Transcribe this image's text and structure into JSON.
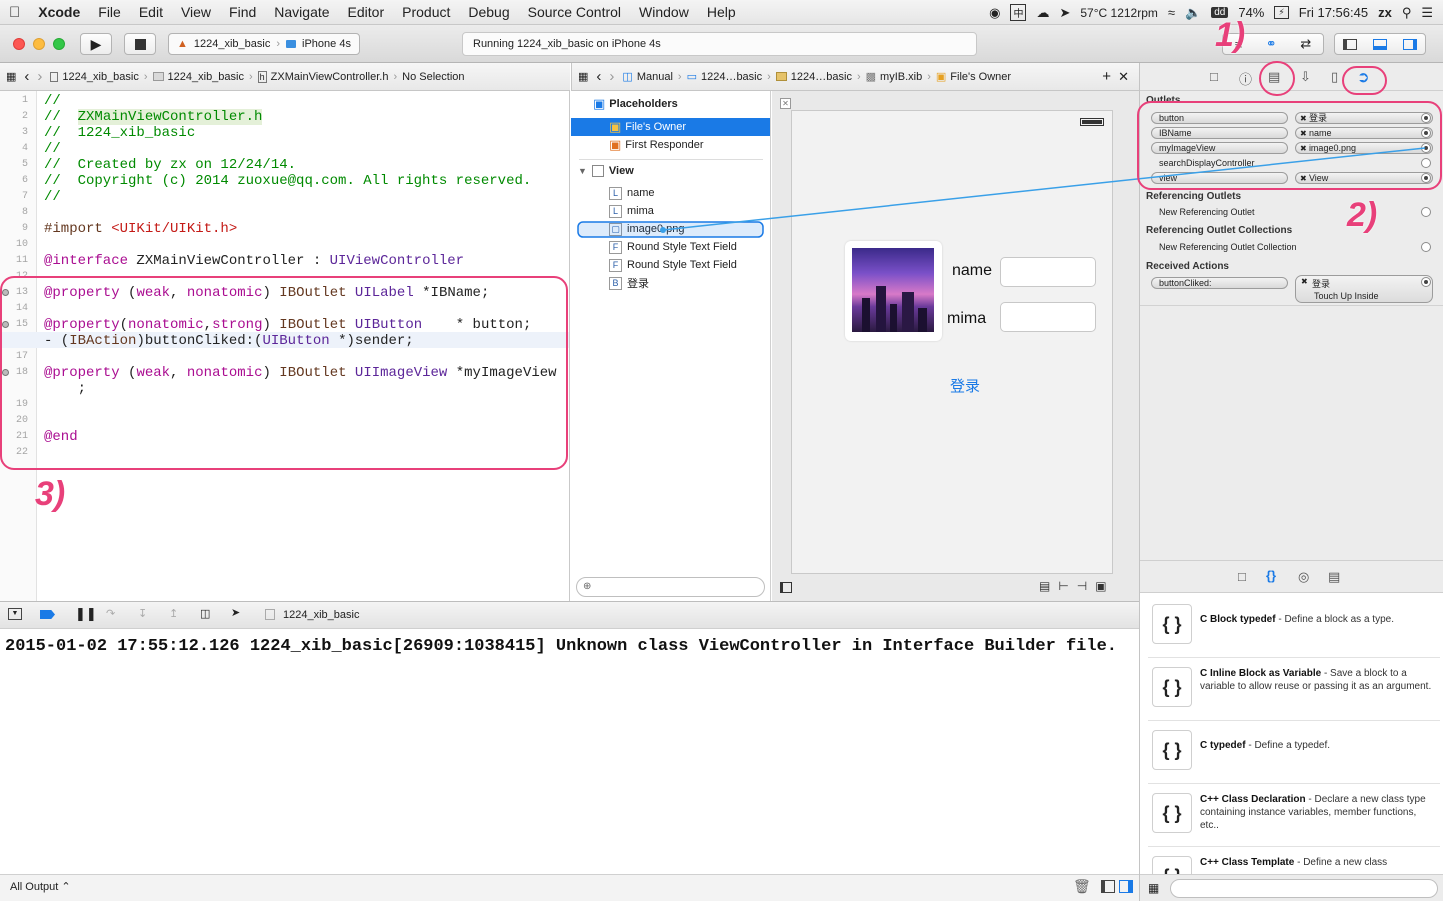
{
  "menubar": {
    "app_name": "Xcode",
    "items": [
      "File",
      "Edit",
      "View",
      "Find",
      "Navigate",
      "Editor",
      "Product",
      "Debug",
      "Source Control",
      "Window",
      "Help"
    ],
    "status": {
      "temp": "57°C 1212rpm",
      "battery": "74%",
      "clock": "Fri 17:56:45",
      "user": "zx"
    }
  },
  "toolbar": {
    "scheme_target": "1224_xib_basic",
    "scheme_device": "iPhone 4s",
    "activity_text": "Running 1224_xib_basic on iPhone 4s"
  },
  "editor_jump": {
    "project": "1224_xib_basic",
    "group": "1224_xib_basic",
    "file": "ZXMainViewController.h",
    "selection": "No Selection"
  },
  "ib_jump": {
    "mode": "Manual",
    "project": "1224…basic",
    "group": "1224…basic",
    "file": "myIB.xib",
    "object": "File's Owner"
  },
  "code": {
    "line_numbers": [
      "1",
      "2",
      "3",
      "4",
      "5",
      "6",
      "7",
      "8",
      "9",
      "10",
      "11",
      "12",
      "13",
      "14",
      "15",
      "16",
      "17",
      "18",
      "",
      "19",
      "20",
      "21",
      "22"
    ],
    "lines": [
      "//",
      "//  ZXMainViewController.h",
      "//  1224_xib_basic",
      "//",
      "//  Created by zx on 12/24/14.",
      "//  Copyright (c) 2014 zuoxue@qq.com. All rights reserved.",
      "//",
      "",
      "#import <UIKit/UIKit.h>",
      "",
      "@interface ZXMainViewController : UIViewController",
      "",
      "@property (weak, nonatomic) IBOutlet UILabel *IBName;",
      "",
      "@property(nonatomic,strong) IBOutlet UIButton    * button;",
      "- (IBAction)buttonCliked:(UIButton *)sender;",
      "",
      "@property (weak, nonatomic) IBOutlet UIImageView *myImageView",
      "    ;",
      "",
      "",
      "@end",
      ""
    ]
  },
  "outline": {
    "placeholders_label": "Placeholders",
    "files_owner": "File's Owner",
    "first_responder": "First Responder",
    "view_label": "View",
    "children": [
      {
        "badge": "L",
        "label": "name"
      },
      {
        "badge": "L",
        "label": "mima"
      },
      {
        "badge": "▢",
        "label": "image0.png"
      },
      {
        "badge": "F",
        "label": "Round Style Text Field"
      },
      {
        "badge": "F",
        "label": "Round Style Text Field"
      },
      {
        "badge": "B",
        "label": "登录"
      }
    ]
  },
  "canvas": {
    "name_label": "name",
    "mima_label": "mima",
    "login_button": "登录"
  },
  "inspector": {
    "outlets_header": "Outlets",
    "outlets": [
      {
        "name": "button",
        "target": "登录",
        "connected": true
      },
      {
        "name": "IBName",
        "target": "name",
        "connected": true
      },
      {
        "name": "myImageView",
        "target": "image0.png",
        "connected": true
      },
      {
        "name": "searchDisplayController",
        "target": "",
        "connected": false
      },
      {
        "name": "view",
        "target": "View",
        "connected": true
      }
    ],
    "ref_outlets_header": "Referencing Outlets",
    "new_ref_outlet": "New Referencing Outlet",
    "ref_collections_header": "Referencing Outlet Collections",
    "new_ref_collection": "New Referencing Outlet Collection",
    "actions_header": "Received Actions",
    "action_name": "buttonCliked:",
    "action_target": "登录",
    "action_event": "Touch Up Inside"
  },
  "library": [
    {
      "title": "C Block typedef",
      "desc": " - Define a block as a type."
    },
    {
      "title": "C Inline Block as Variable",
      "desc": " - Save a block to a variable to allow reuse or passing it as an argument."
    },
    {
      "title": "C typedef",
      "desc": " - Define a typedef."
    },
    {
      "title": "C++ Class Declaration",
      "desc": " - Declare a new class type containing instance variables, member functions, etc.."
    },
    {
      "title": "C++ Class Template",
      "desc": " - Define a new class"
    }
  ],
  "debugbar": {
    "target": "1224_xib_basic"
  },
  "console": {
    "text": "2015-01-02 17:55:12.126 1224_xib_basic[26909:1038415] Unknown class ViewController in Interface Builder file.",
    "footer_label": "All Output ⌃"
  },
  "annotations": [
    "1)",
    "2)",
    "3)"
  ],
  "colors": {
    "accent": "#1a7ae6",
    "annotation": "#e8407a",
    "comment": "#008a00",
    "keyword": "#aa0d91"
  }
}
